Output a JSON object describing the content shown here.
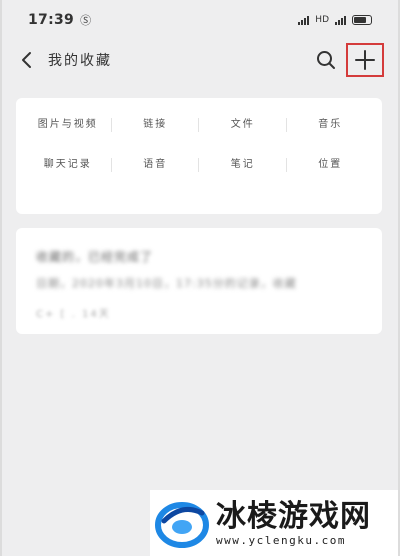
{
  "status_bar": {
    "time": "17:39",
    "notification_glyph": "Ⓢ",
    "network_label": "HD"
  },
  "header": {
    "title": "我的收藏",
    "back_icon": "chevron-left-icon",
    "search_icon": "search-icon",
    "add_icon": "plus-icon",
    "add_highlight_color": "#d43b3b"
  },
  "categories": [
    {
      "label": "图片与视频"
    },
    {
      "label": "链接"
    },
    {
      "label": "文件"
    },
    {
      "label": "音乐"
    },
    {
      "label": "聊天记录"
    },
    {
      "label": "语音"
    },
    {
      "label": "笔记"
    },
    {
      "label": "位置"
    }
  ],
  "favorite_item": {
    "title": "收藏的，已经完成了",
    "description": "日期，2020年3月10日，17:35分的记录，收藏",
    "meta": "C+ [ . 14天"
  },
  "watermark": {
    "text": "冰棱游戏网",
    "url": "www.yclengku.com"
  },
  "colors": {
    "background": "#eeeeef",
    "card": "#ffffff",
    "logo_blue": "#1e88e5"
  }
}
